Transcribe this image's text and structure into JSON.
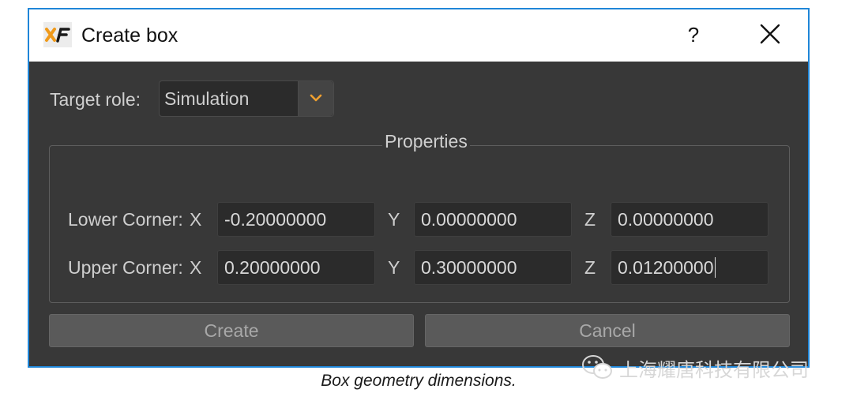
{
  "window": {
    "title": "Create box",
    "help_label": "?",
    "close_icon": "close-icon",
    "app_icon": "xf-app-logo",
    "border_color": "#1f86d8"
  },
  "target_role": {
    "label": "Target role:",
    "value": "Simulation",
    "icon": "chevron-down-icon",
    "accent_color": "#f0a030"
  },
  "properties": {
    "title": "Properties",
    "lower": {
      "label": "Lower Corner:",
      "x_label": "X",
      "x": "-0.20000000",
      "y_label": "Y",
      "y": "0.00000000",
      "z_label": "Z",
      "z": "0.00000000"
    },
    "upper": {
      "label": "Upper Corner:",
      "x_label": "X",
      "x": "0.20000000",
      "y_label": "Y",
      "y": "0.30000000",
      "z_label": "Z",
      "z": "0.01200000"
    }
  },
  "buttons": {
    "create": "Create",
    "cancel": "Cancel"
  },
  "caption": "Box geometry dimensions.",
  "watermark": {
    "text": "上海耀唐科技有限公司",
    "icon": "wechat-icon"
  }
}
